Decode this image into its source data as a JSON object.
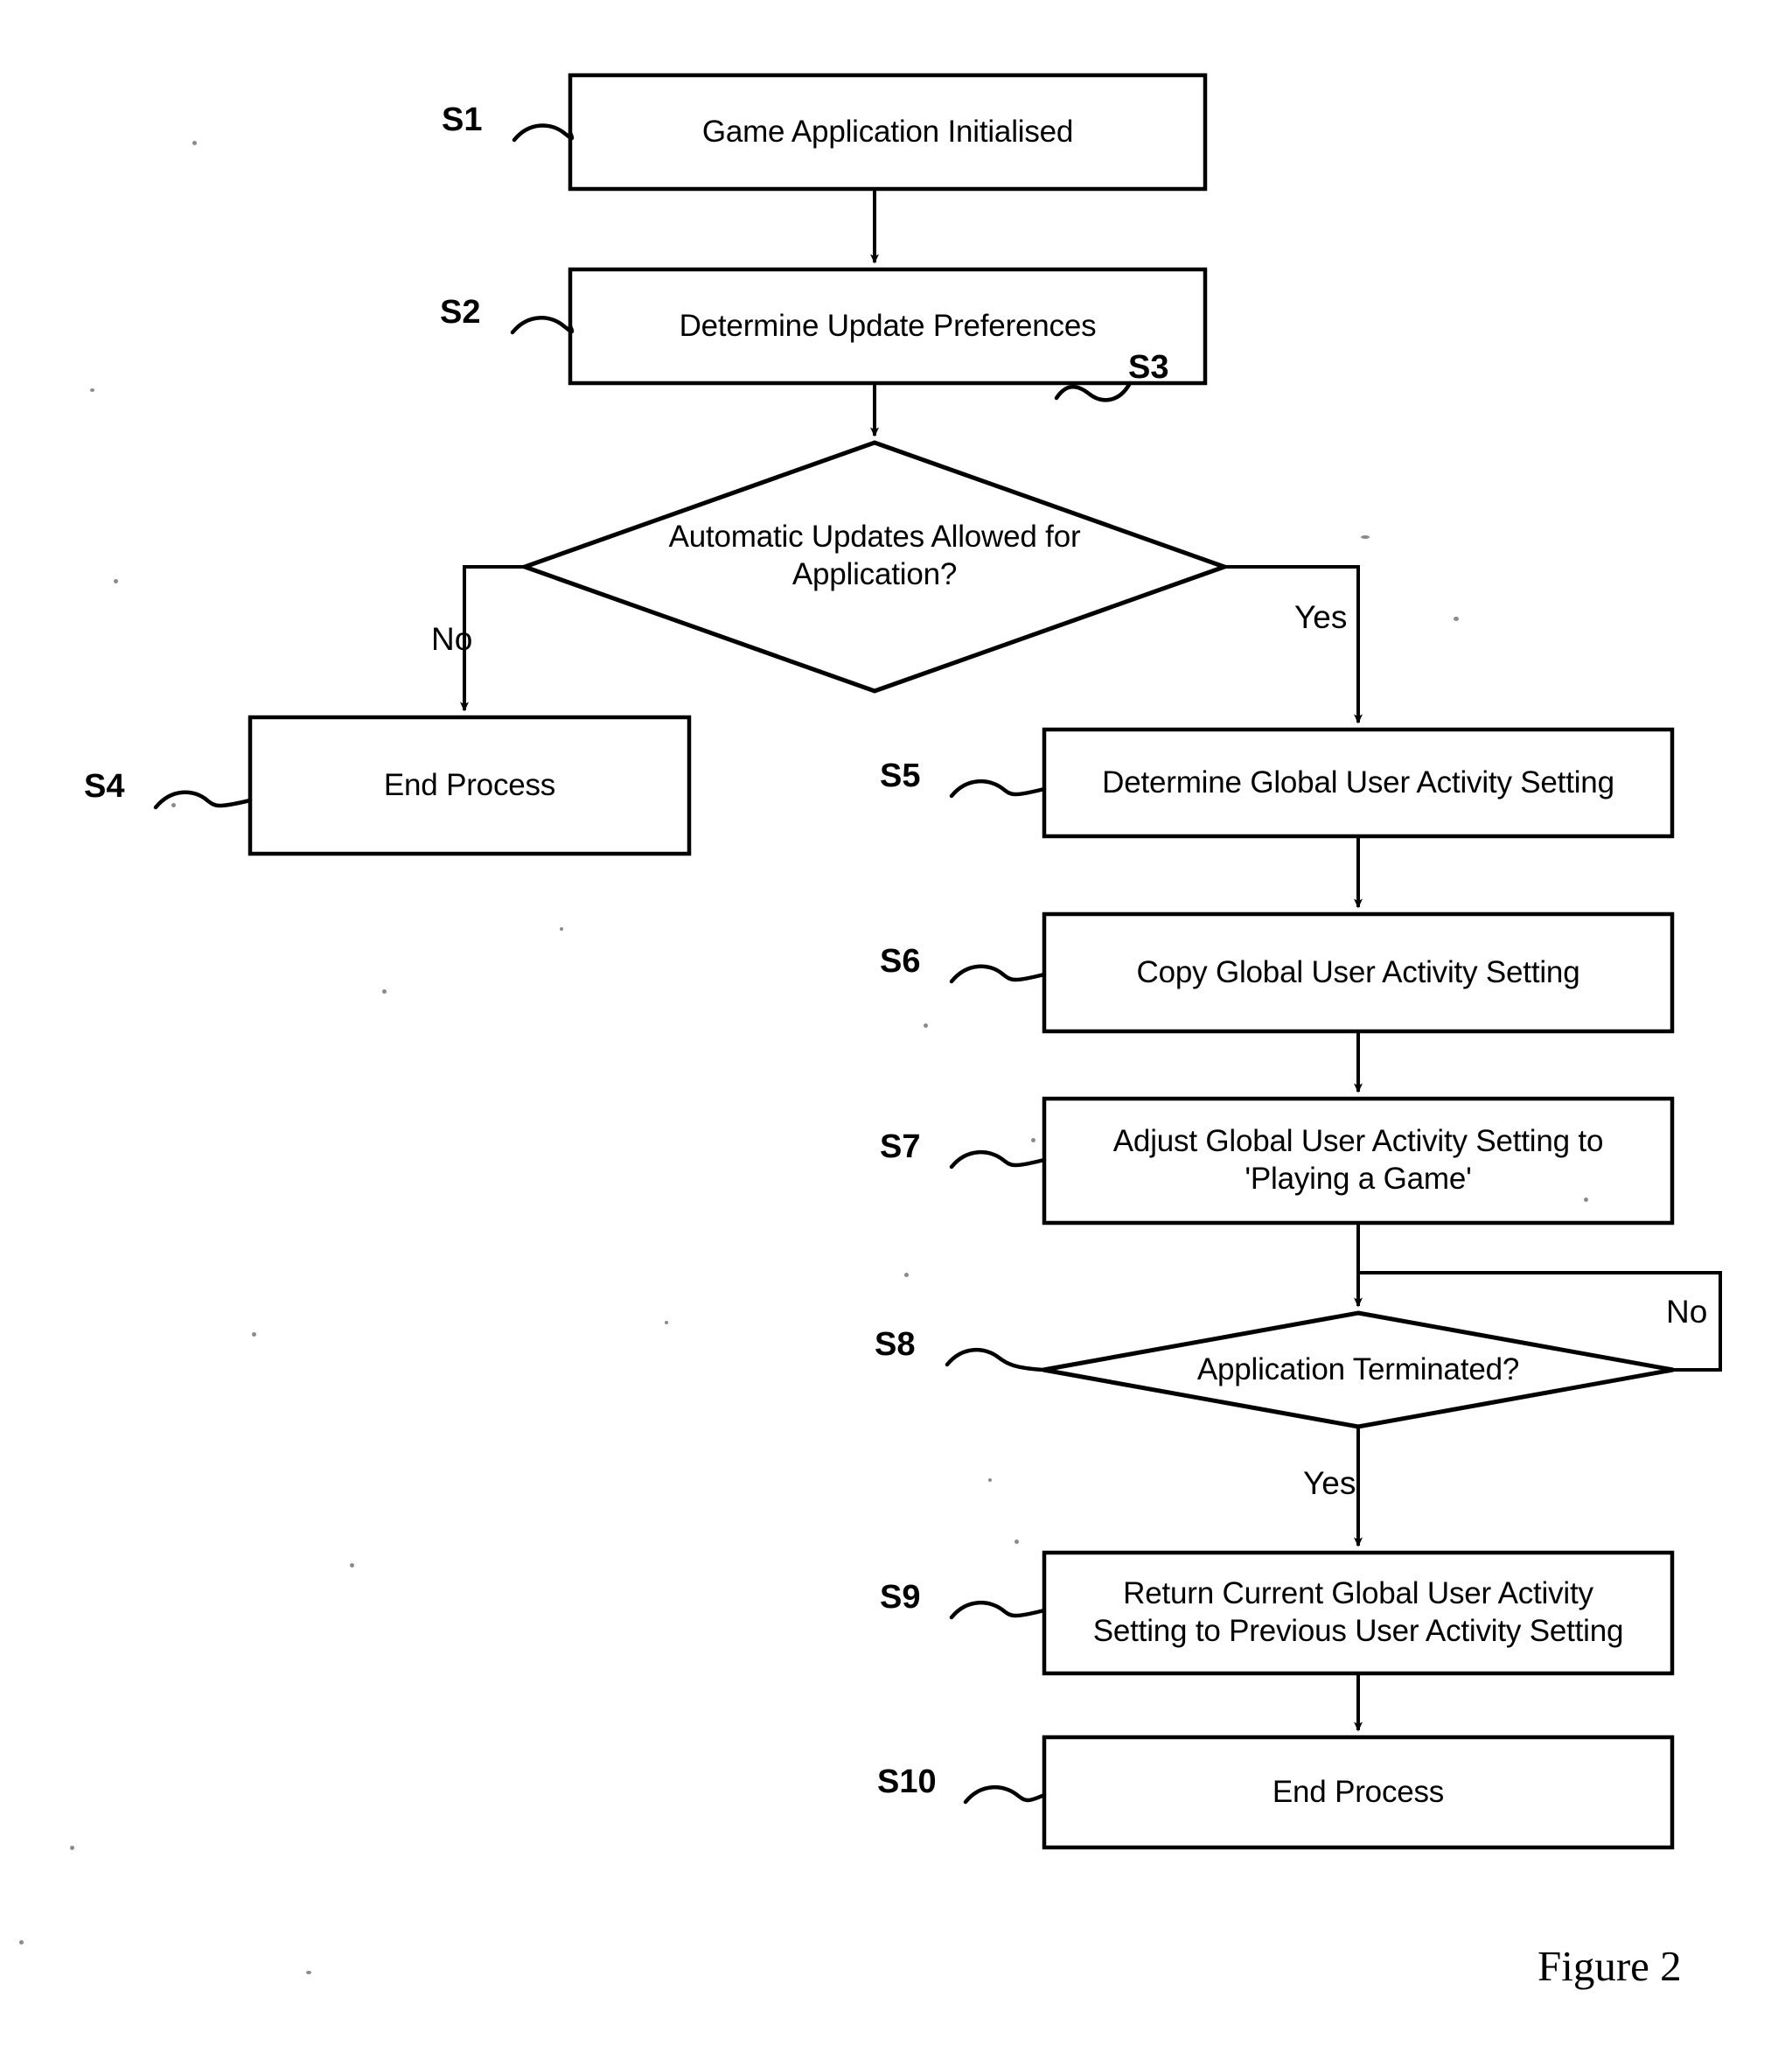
{
  "figure": {
    "caption": "Figure 2",
    "type": "flowchart"
  },
  "edge_labels": {
    "s3_no": "No",
    "s3_yes": "Yes",
    "s8_no": "No",
    "s8_yes": "Yes"
  },
  "steps": [
    {
      "tag": "S1",
      "shape": "process",
      "label": "Game Application Initialised"
    },
    {
      "tag": "S2",
      "shape": "process",
      "label": "Determine Update Preferences"
    },
    {
      "tag": "S3",
      "shape": "decision",
      "label": "Automatic Updates Allowed for\nApplication?"
    },
    {
      "tag": "S4",
      "shape": "process",
      "label": "End Process"
    },
    {
      "tag": "S5",
      "shape": "process",
      "label": "Determine Global User Activity Setting"
    },
    {
      "tag": "S6",
      "shape": "process",
      "label": "Copy Global User Activity Setting"
    },
    {
      "tag": "S7",
      "shape": "process",
      "label": "Adjust Global User Activity Setting to\n'Playing a Game'"
    },
    {
      "tag": "S8",
      "shape": "decision",
      "label": "Application Terminated?"
    },
    {
      "tag": "S9",
      "shape": "process",
      "label": "Return Current Global User Activity\nSetting to Previous User Activity Setting"
    },
    {
      "tag": "S10",
      "shape": "process",
      "label": "End Process"
    }
  ],
  "colors": {
    "stroke": "#000000",
    "background": "#ffffff",
    "text": "#000000"
  }
}
